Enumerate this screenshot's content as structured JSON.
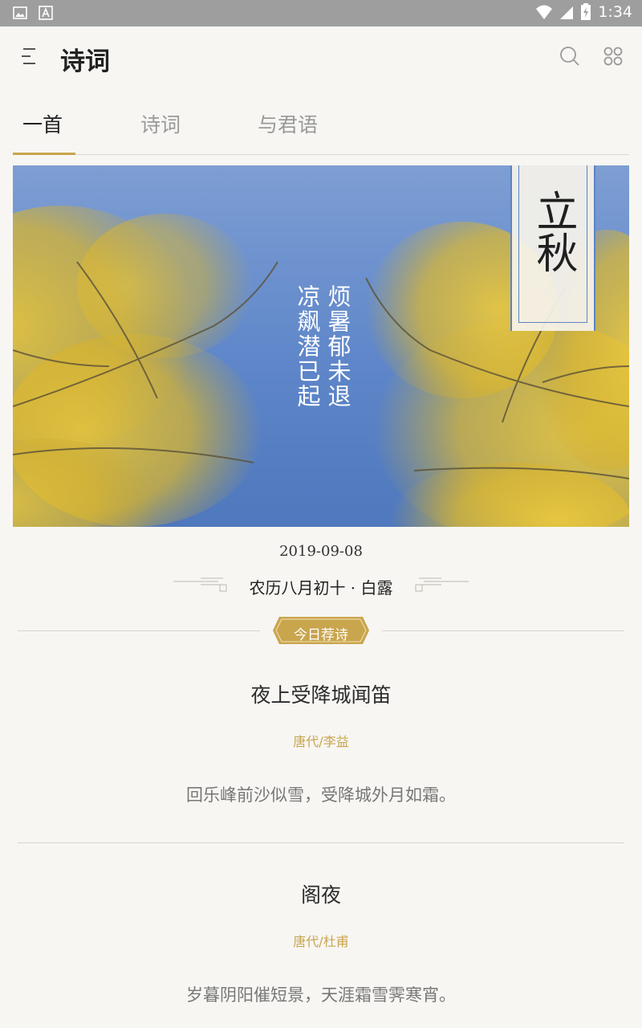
{
  "status_bar": {
    "time": "1:34"
  },
  "app_bar": {
    "title": "诗词"
  },
  "tabs": [
    {
      "label": "一首",
      "active": true
    },
    {
      "label": "诗词",
      "active": false
    },
    {
      "label": "与君语",
      "active": false
    }
  ],
  "banner": {
    "solar_term": "立秋",
    "poem_lines": [
      "烦暑郁未退",
      "凉飙潜已起"
    ]
  },
  "date": {
    "gregorian": "2019-09-08",
    "lunar": "农历八月初十 · 白露"
  },
  "recommend_badge": "今日荐诗",
  "poems": [
    {
      "title": "夜上受降城闻笛",
      "author": "唐代/李益",
      "line": "回乐峰前沙似雪，受降城外月如霜。"
    },
    {
      "title": "阁夜",
      "author": "唐代/杜甫",
      "line": "岁暮阴阳催短景，天涯霜雪霁寒宵。"
    }
  ],
  "colors": {
    "accent_gold": "#c9a54e",
    "sky_blue": "#5e86c9",
    "background": "#f7f6f3"
  }
}
